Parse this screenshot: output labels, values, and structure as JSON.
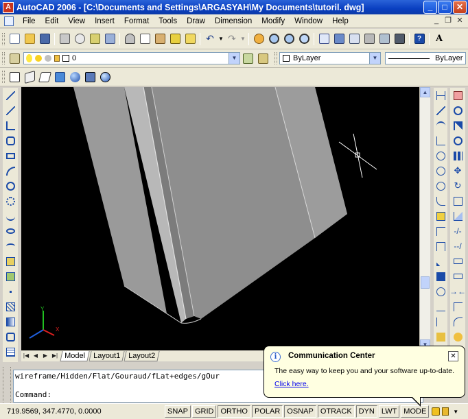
{
  "window": {
    "title": "AutoCAD 2006 - [C:\\Documents and Settings\\ARGASYAH\\My Documents\\tutoril. dwg]",
    "app_icon": "A",
    "buttons": {
      "minimize": "_",
      "maximize": "□",
      "close": "✕"
    }
  },
  "menu": {
    "items": [
      "File",
      "Edit",
      "View",
      "Insert",
      "Format",
      "Tools",
      "Draw",
      "Dimension",
      "Modify",
      "Window",
      "Help"
    ],
    "mdi": {
      "minimize": "_",
      "restore": "❐",
      "close": "✕"
    }
  },
  "layers": {
    "current_layer": "0",
    "color_control": "ByLayer",
    "linetype_control": "ByLayer"
  },
  "layout_tabs": {
    "nav": [
      "|◀",
      "◀",
      "▶",
      "▶|"
    ],
    "tabs": [
      "Model",
      "Layout1",
      "Layout2"
    ],
    "active": "Model"
  },
  "command": {
    "history_line": "wireframe/Hidden/Flat/Gouraud/fLat+edges/gOur",
    "prompt": "Command:"
  },
  "status": {
    "coordinates": "719.9569, 347.4770, 0.0000",
    "toggles": [
      "SNAP",
      "GRID",
      "ORTHO",
      "POLAR",
      "OSNAP",
      "OTRACK",
      "DYN",
      "LWT",
      "MODE"
    ]
  },
  "balloon": {
    "title": "Communication Center",
    "body": "The easy way to keep you and your software up-to-date.",
    "link": "Click here.",
    "close": "✕",
    "info_icon": "i"
  },
  "ucs": {
    "x_label": "X",
    "y_label": "Y"
  },
  "colors": {
    "titlebar": "#0a3fc1",
    "canvas": "#000000",
    "panel": "#ece9d8",
    "shape_face": "#8c8c8c",
    "balloon": "#ffffe1"
  }
}
